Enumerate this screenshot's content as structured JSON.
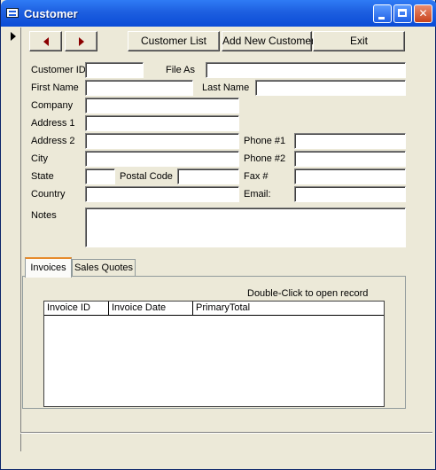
{
  "window": {
    "title": "Customer"
  },
  "nav": {
    "prev_icon": "triangle-left-icon",
    "next_icon": "triangle-right-icon",
    "customer_list_label": "Customer List",
    "add_new_customer_label": "Add New Customer",
    "exit_label": "Exit"
  },
  "form": {
    "customer_id": {
      "label": "Customer ID",
      "value": ""
    },
    "file_as": {
      "label": "File As",
      "value": ""
    },
    "first_name": {
      "label": "First Name",
      "value": ""
    },
    "last_name": {
      "label": "Last Name",
      "value": ""
    },
    "company": {
      "label": "Company",
      "value": ""
    },
    "address1": {
      "label": "Address 1",
      "value": ""
    },
    "address2": {
      "label": "Address 2",
      "value": ""
    },
    "phone1": {
      "label": "Phone #1",
      "value": ""
    },
    "city": {
      "label": "City",
      "value": ""
    },
    "phone2": {
      "label": "Phone #2",
      "value": ""
    },
    "state": {
      "label": "State",
      "value": ""
    },
    "postal_code": {
      "label": "Postal Code",
      "value": ""
    },
    "fax": {
      "label": "Fax #",
      "value": ""
    },
    "country": {
      "label": "Country",
      "value": ""
    },
    "email": {
      "label": "Email:",
      "value": ""
    },
    "notes": {
      "label": "Notes",
      "value": ""
    }
  },
  "tabs": [
    {
      "label": "Invoices",
      "active": true
    },
    {
      "label": "Sales Quotes",
      "active": false
    }
  ],
  "invoices": {
    "hint": "Double-Click to open record",
    "columns": [
      "Invoice ID",
      "Invoice Date",
      "PrimaryTotal"
    ],
    "rows": []
  },
  "colors": {
    "titlebar": "#0a4bd6",
    "face": "#ece9d8",
    "nav_arrow": "#8b0000",
    "active_tab_accent": "#e68b2c"
  }
}
